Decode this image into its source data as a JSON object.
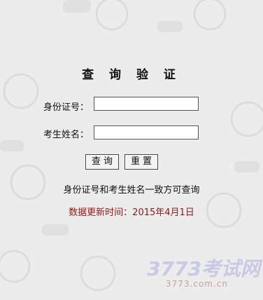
{
  "title": "查 询 验 证",
  "form": {
    "id_label": "身份证号：",
    "id_value": "",
    "name_label": "考生姓名：",
    "name_value": ""
  },
  "buttons": {
    "query": "查询",
    "reset": "重置"
  },
  "hint": "身份证号和考生姓名一致方可查询",
  "update_notice": "数据更新时间：2015年4月1日",
  "watermark": {
    "logo_text": "3773考试网",
    "logo_url": "3773.com.cn"
  },
  "colors": {
    "background": "#ececec",
    "notice": "#8b1a1a",
    "logo": "#c9c9e6"
  }
}
